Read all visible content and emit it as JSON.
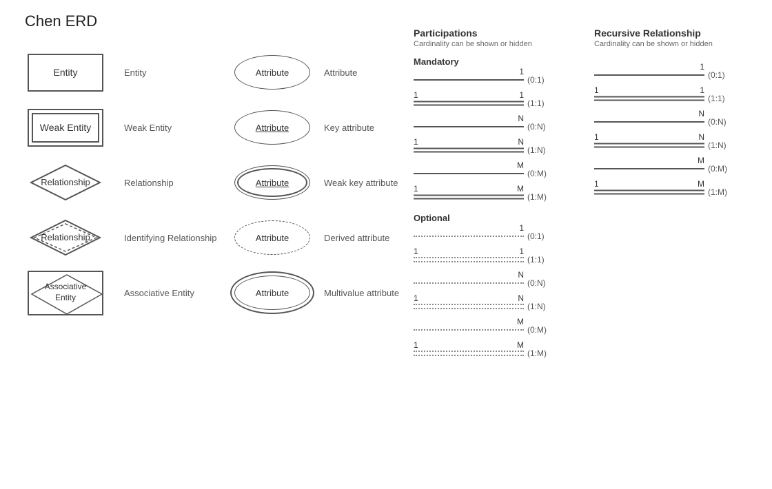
{
  "title": "Chen ERD",
  "shapes": [
    {
      "type": "entity",
      "label": "Entity",
      "shape_text": "Entity"
    },
    {
      "type": "weak_entity",
      "label": "Weak Entity",
      "shape_text": "Weak Entity"
    },
    {
      "type": "relationship",
      "label": "Relationship",
      "shape_text": "Relationship"
    },
    {
      "type": "identifying_relationship",
      "label": "Identifying Relationship",
      "shape_text": "Relationship"
    },
    {
      "type": "associative_entity",
      "label": "Associative Entity",
      "shape_text": "Associative\nEntity"
    }
  ],
  "attributes": [
    {
      "type": "regular",
      "label": "Attribute",
      "shape_text": "Attribute"
    },
    {
      "type": "key",
      "label": "Key attribute",
      "shape_text": "Attribute"
    },
    {
      "type": "weak_key",
      "label": "Weak key attribute",
      "shape_text": "Attribute"
    },
    {
      "type": "derived",
      "label": "Derived attribute",
      "shape_text": "Attribute"
    },
    {
      "type": "multivalue",
      "label": "Multivalue attribute",
      "shape_text": "Attribute"
    }
  ],
  "participations": {
    "title": "Participations",
    "subtitle": "Cardinality can be shown or hidden",
    "mandatory": {
      "label": "Mandatory",
      "rows": [
        {
          "left": "",
          "right": "1",
          "notation": "(0:1)",
          "line": "single"
        },
        {
          "left": "1",
          "right": "1",
          "notation": "(1:1)",
          "line": "double"
        },
        {
          "left": "",
          "right": "N",
          "notation": "(0:N)",
          "line": "single"
        },
        {
          "left": "1",
          "right": "N",
          "notation": "(1:N)",
          "line": "double"
        },
        {
          "left": "",
          "right": "M",
          "notation": "(0:M)",
          "line": "single"
        },
        {
          "left": "1",
          "right": "M",
          "notation": "(1:M)",
          "line": "double"
        }
      ]
    },
    "optional": {
      "label": "Optional",
      "rows": [
        {
          "left": "",
          "right": "1",
          "notation": "(0:1)",
          "line": "dashed"
        },
        {
          "left": "1",
          "right": "1",
          "notation": "(1:1)",
          "line": "dashed_double"
        },
        {
          "left": "",
          "right": "N",
          "notation": "(0:N)",
          "line": "dashed"
        },
        {
          "left": "1",
          "right": "N",
          "notation": "(1:N)",
          "line": "dashed_double"
        },
        {
          "left": "",
          "right": "M",
          "notation": "(0:M)",
          "line": "dashed"
        },
        {
          "left": "1",
          "right": "M",
          "notation": "(1:M)",
          "line": "dashed_double"
        }
      ]
    }
  },
  "recursive": {
    "title": "Recursive Relationship",
    "subtitle": "Cardinality can be shown or hidden",
    "rows": [
      {
        "left": "",
        "right": "1",
        "notation": "(0:1)",
        "line": "single"
      },
      {
        "left": "1",
        "right": "1",
        "notation": "(1:1)",
        "line": "double"
      },
      {
        "left": "",
        "right": "N",
        "notation": "(0:N)",
        "line": "single"
      },
      {
        "left": "1",
        "right": "N",
        "notation": "(1:N)",
        "line": "double"
      },
      {
        "left": "",
        "right": "M",
        "notation": "(0:M)",
        "line": "single"
      },
      {
        "left": "1",
        "right": "M",
        "notation": "(1:M)",
        "line": "double"
      }
    ]
  }
}
